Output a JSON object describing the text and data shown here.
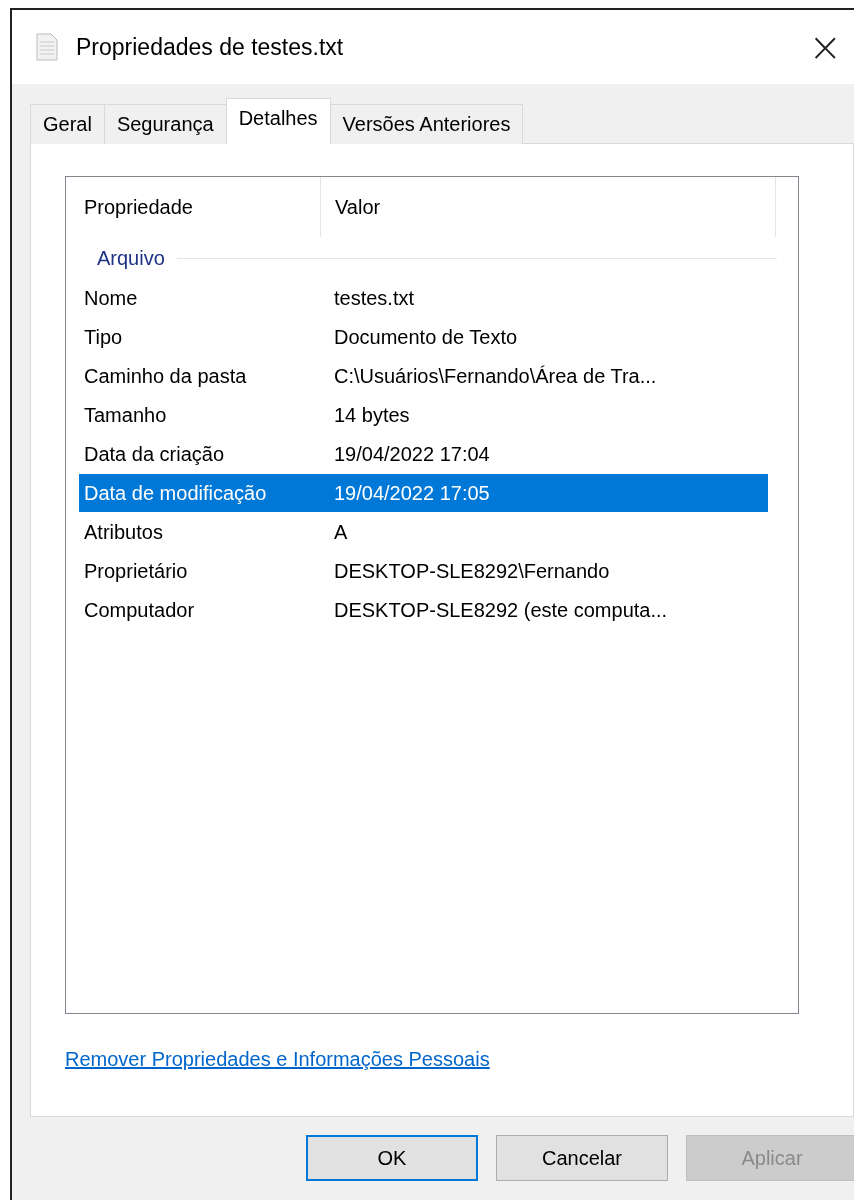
{
  "window": {
    "title": "Propriedades de testes.txt",
    "close": "×"
  },
  "tabs": [
    {
      "label": "Geral",
      "selected": false
    },
    {
      "label": "Segurança",
      "selected": false
    },
    {
      "label": "Detalhes",
      "selected": true
    },
    {
      "label": "Versões Anteriores",
      "selected": false
    }
  ],
  "table": {
    "columns": [
      "Propriedade",
      "Valor"
    ],
    "group": "Arquivo",
    "rows": [
      {
        "property": "Nome",
        "value": "testes.txt",
        "selected": false
      },
      {
        "property": "Tipo",
        "value": "Documento de Texto",
        "selected": false
      },
      {
        "property": "Caminho da pasta",
        "value": "C:\\Usuários\\Fernando\\Área de Tra...",
        "selected": false
      },
      {
        "property": "Tamanho",
        "value": "14 bytes",
        "selected": false
      },
      {
        "property": "Data da criação",
        "value": "19/04/2022 17:04",
        "selected": false
      },
      {
        "property": "Data de modificação",
        "value": "19/04/2022 17:05",
        "selected": true
      },
      {
        "property": "Atributos",
        "value": "A",
        "selected": false
      },
      {
        "property": "Proprietário",
        "value": "DESKTOP-SLE8292\\Fernando",
        "selected": false
      },
      {
        "property": "Computador",
        "value": "DESKTOP-SLE8292 (este computa...",
        "selected": false
      }
    ]
  },
  "link": "Remover Propriedades e Informações Pessoais",
  "buttons": [
    {
      "label": "OK",
      "default": true,
      "disabled": false
    },
    {
      "label": "Cancelar",
      "default": false,
      "disabled": false
    },
    {
      "label": "Aplicar",
      "default": false,
      "disabled": true
    }
  ]
}
